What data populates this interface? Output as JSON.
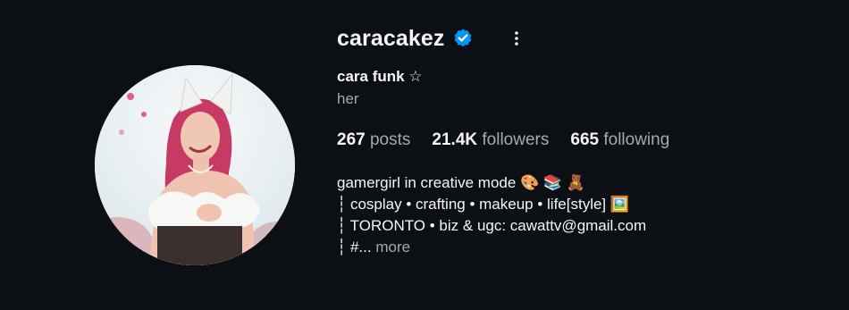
{
  "profile": {
    "username": "caracakez",
    "full_name": "cara funk ☆",
    "pronouns": "her",
    "icons": {
      "verified": "verified-badge-icon",
      "more": "more-options-icon"
    },
    "colors": {
      "verified": "#0095f6",
      "background": "#0c1014"
    }
  },
  "stats": {
    "posts": {
      "value": "267",
      "label": "posts"
    },
    "followers": {
      "value": "21.4K",
      "label": "followers"
    },
    "following": {
      "value": "665",
      "label": "following"
    }
  },
  "bio": {
    "line1": "gamergirl in creative mode 🎨 📚 🧸",
    "line2": "┆ cosplay • crafting • makeup • life[style]  🖼️",
    "line3": "┆ TORONTO • biz & ugc: cawattv@gmail.com",
    "line4_prefix": "┆ #...",
    "more_label": "more"
  }
}
